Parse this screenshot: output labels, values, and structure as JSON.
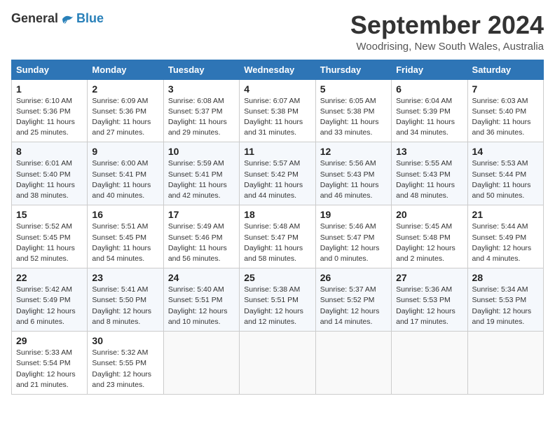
{
  "header": {
    "logo_general": "General",
    "logo_blue": "Blue",
    "month_title": "September 2024",
    "location": "Woodrising, New South Wales, Australia"
  },
  "weekdays": [
    "Sunday",
    "Monday",
    "Tuesday",
    "Wednesday",
    "Thursday",
    "Friday",
    "Saturday"
  ],
  "weeks": [
    [
      {
        "day": "1",
        "sunrise": "6:10 AM",
        "sunset": "5:36 PM",
        "daylight": "11 hours and 25 minutes."
      },
      {
        "day": "2",
        "sunrise": "6:09 AM",
        "sunset": "5:36 PM",
        "daylight": "11 hours and 27 minutes."
      },
      {
        "day": "3",
        "sunrise": "6:08 AM",
        "sunset": "5:37 PM",
        "daylight": "11 hours and 29 minutes."
      },
      {
        "day": "4",
        "sunrise": "6:07 AM",
        "sunset": "5:38 PM",
        "daylight": "11 hours and 31 minutes."
      },
      {
        "day": "5",
        "sunrise": "6:05 AM",
        "sunset": "5:38 PM",
        "daylight": "11 hours and 33 minutes."
      },
      {
        "day": "6",
        "sunrise": "6:04 AM",
        "sunset": "5:39 PM",
        "daylight": "11 hours and 34 minutes."
      },
      {
        "day": "7",
        "sunrise": "6:03 AM",
        "sunset": "5:40 PM",
        "daylight": "11 hours and 36 minutes."
      }
    ],
    [
      {
        "day": "8",
        "sunrise": "6:01 AM",
        "sunset": "5:40 PM",
        "daylight": "11 hours and 38 minutes."
      },
      {
        "day": "9",
        "sunrise": "6:00 AM",
        "sunset": "5:41 PM",
        "daylight": "11 hours and 40 minutes."
      },
      {
        "day": "10",
        "sunrise": "5:59 AM",
        "sunset": "5:41 PM",
        "daylight": "11 hours and 42 minutes."
      },
      {
        "day": "11",
        "sunrise": "5:57 AM",
        "sunset": "5:42 PM",
        "daylight": "11 hours and 44 minutes."
      },
      {
        "day": "12",
        "sunrise": "5:56 AM",
        "sunset": "5:43 PM",
        "daylight": "11 hours and 46 minutes."
      },
      {
        "day": "13",
        "sunrise": "5:55 AM",
        "sunset": "5:43 PM",
        "daylight": "11 hours and 48 minutes."
      },
      {
        "day": "14",
        "sunrise": "5:53 AM",
        "sunset": "5:44 PM",
        "daylight": "11 hours and 50 minutes."
      }
    ],
    [
      {
        "day": "15",
        "sunrise": "5:52 AM",
        "sunset": "5:45 PM",
        "daylight": "11 hours and 52 minutes."
      },
      {
        "day": "16",
        "sunrise": "5:51 AM",
        "sunset": "5:45 PM",
        "daylight": "11 hours and 54 minutes."
      },
      {
        "day": "17",
        "sunrise": "5:49 AM",
        "sunset": "5:46 PM",
        "daylight": "11 hours and 56 minutes."
      },
      {
        "day": "18",
        "sunrise": "5:48 AM",
        "sunset": "5:47 PM",
        "daylight": "11 hours and 58 minutes."
      },
      {
        "day": "19",
        "sunrise": "5:46 AM",
        "sunset": "5:47 PM",
        "daylight": "12 hours and 0 minutes."
      },
      {
        "day": "20",
        "sunrise": "5:45 AM",
        "sunset": "5:48 PM",
        "daylight": "12 hours and 2 minutes."
      },
      {
        "day": "21",
        "sunrise": "5:44 AM",
        "sunset": "5:49 PM",
        "daylight": "12 hours and 4 minutes."
      }
    ],
    [
      {
        "day": "22",
        "sunrise": "5:42 AM",
        "sunset": "5:49 PM",
        "daylight": "12 hours and 6 minutes."
      },
      {
        "day": "23",
        "sunrise": "5:41 AM",
        "sunset": "5:50 PM",
        "daylight": "12 hours and 8 minutes."
      },
      {
        "day": "24",
        "sunrise": "5:40 AM",
        "sunset": "5:51 PM",
        "daylight": "12 hours and 10 minutes."
      },
      {
        "day": "25",
        "sunrise": "5:38 AM",
        "sunset": "5:51 PM",
        "daylight": "12 hours and 12 minutes."
      },
      {
        "day": "26",
        "sunrise": "5:37 AM",
        "sunset": "5:52 PM",
        "daylight": "12 hours and 14 minutes."
      },
      {
        "day": "27",
        "sunrise": "5:36 AM",
        "sunset": "5:53 PM",
        "daylight": "12 hours and 17 minutes."
      },
      {
        "day": "28",
        "sunrise": "5:34 AM",
        "sunset": "5:53 PM",
        "daylight": "12 hours and 19 minutes."
      }
    ],
    [
      {
        "day": "29",
        "sunrise": "5:33 AM",
        "sunset": "5:54 PM",
        "daylight": "12 hours and 21 minutes."
      },
      {
        "day": "30",
        "sunrise": "5:32 AM",
        "sunset": "5:55 PM",
        "daylight": "12 hours and 23 minutes."
      },
      null,
      null,
      null,
      null,
      null
    ]
  ]
}
